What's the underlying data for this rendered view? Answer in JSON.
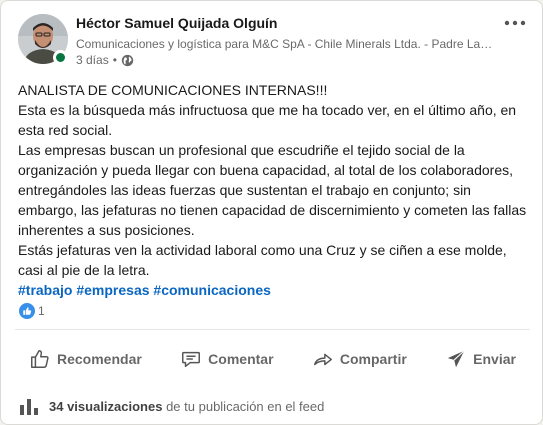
{
  "post": {
    "author": {
      "name": "Héctor Samuel Quijada Olguín",
      "headline": "Comunicaciones y logística para M&C SpA - Chile Minerals Ltda. - Padre Lam…",
      "time": "3 días",
      "separator": "•",
      "visibility_icon": "globe-icon",
      "presence": "online"
    },
    "menu_icon": "more-horizontal-icon",
    "text": {
      "p1": "ANALISTA DE COMUNICACIONES INTERNAS!!!",
      "p2": "Esta es la búsqueda más infructuosa que me ha tocado ver, en el último año, en esta red social.",
      "p3": "Las empresas buscan un profesional que escudriñe el tejido social de la organización y pueda llegar con buena capacidad, al total de los colaboradores, entregándoles las ideas fuerzas que sustentan el trabajo en conjunto; sin embargo, las jefaturas no tienen capacidad de discernimiento y cometen las fallas inherentes a sus posiciones.",
      "p4": "Estás jefaturas ven la actividad laboral como una Cruz y se ciñen a ese molde, casi al pie de la letra."
    },
    "hashtags": [
      "#trabajo",
      "#empresas",
      "#comunicaciones"
    ],
    "reactions": {
      "icon": "like-icon",
      "count": "1"
    }
  },
  "actions": {
    "like": "Recomendar",
    "comment": "Comentar",
    "share": "Compartir",
    "send": "Enviar"
  },
  "views": {
    "count": "34 visualizaciones",
    "suffix": "de tu publicación en el feed",
    "icon": "bar-chart-icon"
  },
  "colors": {
    "link": "#0a66c2",
    "presence": "#057642",
    "like_badge": "#378fe9"
  }
}
